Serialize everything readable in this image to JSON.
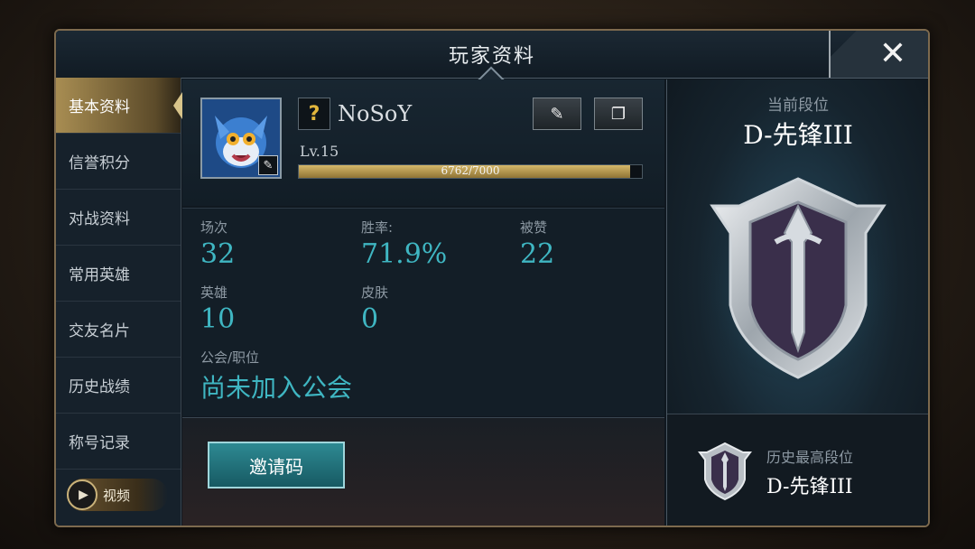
{
  "header": {
    "title": "玩家资料",
    "close_icon": "close-icon"
  },
  "sidebar": {
    "items": [
      {
        "label": "基本资料",
        "active": true
      },
      {
        "label": "信誉积分"
      },
      {
        "label": "对战资料"
      },
      {
        "label": "常用英雄"
      },
      {
        "label": "交友名片"
      },
      {
        "label": "历史战绩"
      },
      {
        "label": "称号记录"
      }
    ],
    "video": {
      "label": "视频",
      "icon": "play-icon"
    }
  },
  "profile": {
    "help_badge": "?",
    "name": "NoSoY",
    "level": "Lv.15",
    "xp": {
      "text": "6762/7000",
      "current": 6762,
      "max": 7000
    }
  },
  "stats": {
    "matches": {
      "label": "场次",
      "value": "32"
    },
    "winrate": {
      "label": "胜率:",
      "value": "71.9%"
    },
    "likes": {
      "label": "被赞",
      "value": "22"
    },
    "heroes": {
      "label": "英雄",
      "value": "10"
    },
    "skins": {
      "label": "皮肤",
      "value": "0"
    },
    "guild": {
      "label": "公会/职位",
      "value": "尚未加入公会"
    }
  },
  "invite": {
    "label": "邀请码"
  },
  "rank": {
    "current_label": "当前段位",
    "current_value": "D-先锋III",
    "best_label": "历史最高段位",
    "best_value": "D-先锋III"
  },
  "colors": {
    "accent_teal": "#3fb6c2",
    "gold": "#c9a85a"
  }
}
